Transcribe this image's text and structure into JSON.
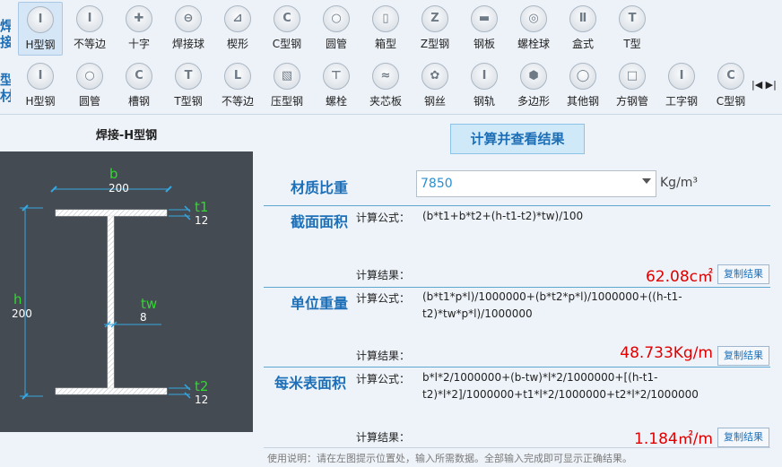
{
  "toolbar": {
    "group1_label": "焊\n接",
    "group2_label": "型\n材",
    "row1": [
      {
        "label": "H型钢",
        "icon": "i-beam-icon",
        "glyph": "I",
        "selected": true
      },
      {
        "label": "不等边",
        "icon": "unequal-i-beam-icon",
        "glyph": "I"
      },
      {
        "label": "十字",
        "icon": "cross-section-icon",
        "glyph": "✚"
      },
      {
        "label": "焊接球",
        "icon": "welded-ball-icon",
        "glyph": "⊖"
      },
      {
        "label": "楔形",
        "icon": "wedge-icon",
        "glyph": "⊿"
      },
      {
        "label": "C型钢",
        "icon": "c-channel-icon",
        "glyph": "C"
      },
      {
        "label": "圆管",
        "icon": "round-tube-icon",
        "glyph": "○"
      },
      {
        "label": "箱型",
        "icon": "box-section-icon",
        "glyph": "▯"
      },
      {
        "label": "Z型钢",
        "icon": "z-section-icon",
        "glyph": "Z"
      },
      {
        "label": "钢板",
        "icon": "steel-plate-icon",
        "glyph": "▬"
      },
      {
        "label": "螺栓球",
        "icon": "bolt-ball-icon",
        "glyph": "◎"
      },
      {
        "label": "盒式",
        "icon": "box-type-icon",
        "glyph": "Ⅱ"
      },
      {
        "label": "T型",
        "icon": "t-section-icon",
        "glyph": "T"
      }
    ],
    "row2": [
      {
        "label": "H型钢",
        "icon": "i-beam-icon",
        "glyph": "I"
      },
      {
        "label": "圆管",
        "icon": "round-tube-icon",
        "glyph": "○"
      },
      {
        "label": "槽钢",
        "icon": "channel-icon",
        "glyph": "C"
      },
      {
        "label": "T型钢",
        "icon": "t-section-icon",
        "glyph": "T"
      },
      {
        "label": "不等边",
        "icon": "angle-icon",
        "glyph": "L"
      },
      {
        "label": "压型钢",
        "icon": "profiled-steel-icon",
        "glyph": "▧"
      },
      {
        "label": "螺栓",
        "icon": "bolt-icon",
        "glyph": "⊤"
      },
      {
        "label": "夹芯板",
        "icon": "sandwich-panel-icon",
        "glyph": "≈"
      },
      {
        "label": "钢丝",
        "icon": "steel-wire-icon",
        "glyph": "✿"
      },
      {
        "label": "钢轨",
        "icon": "rail-icon",
        "glyph": "I"
      },
      {
        "label": "多边形",
        "icon": "polygon-icon",
        "glyph": "⬢"
      },
      {
        "label": "其他钢",
        "icon": "other-steel-icon",
        "glyph": "◯"
      },
      {
        "label": "方钢管",
        "icon": "square-tube-icon",
        "glyph": "□"
      },
      {
        "label": "工字钢",
        "icon": "i-section-icon",
        "glyph": "I"
      },
      {
        "label": "C型钢",
        "icon": "c-channel-icon",
        "glyph": "C"
      }
    ],
    "scroll_arrows": "|◀ ▶|"
  },
  "left": {
    "title": "焊接-H型钢",
    "labels": {
      "b": "b",
      "b_val": "200",
      "t1": "t1",
      "t1_val": "12",
      "h": "h",
      "h_val": "200",
      "tw": "tw",
      "tw_val": "8",
      "t2": "t2",
      "t2_val": "12"
    }
  },
  "main": {
    "calc_button": "计算并查看结果",
    "density": {
      "label": "材质比重",
      "value": "7850",
      "unit": "Kg/m³"
    },
    "formula_label": "计算公式：",
    "result_label": "计算结果：",
    "copy_label": "复制结果",
    "section_area": {
      "label": "截面面积",
      "formula": "(b*t1+b*t2+(h-t1-t2)*tw)/100",
      "result": "62.08c㎡"
    },
    "unit_weight": {
      "label": "单位重量",
      "formula": "(b*t1*p*l)/1000000+(b*t2*p*l)/1000000+((h-t1-t2)*tw*p*l)/1000000",
      "result": "48.733Kg/m"
    },
    "surface_area": {
      "label": "每米表面积",
      "formula": "b*l*2/1000000+(b-tw)*l*2/1000000+[(h-t1-t2)*l*2]/1000000+t1*l*2/1000000+t2*l*2/1000000",
      "result": "1.184㎡/m"
    },
    "footer": "使用说明：请在左图提示位置处，输入所需数据。全部输入完成即可显示正确结果。"
  },
  "colors": {
    "accent": "#1d6fb8",
    "result": "#e00000",
    "dimension": "#33d633",
    "diagram_bg": "#454b52"
  }
}
